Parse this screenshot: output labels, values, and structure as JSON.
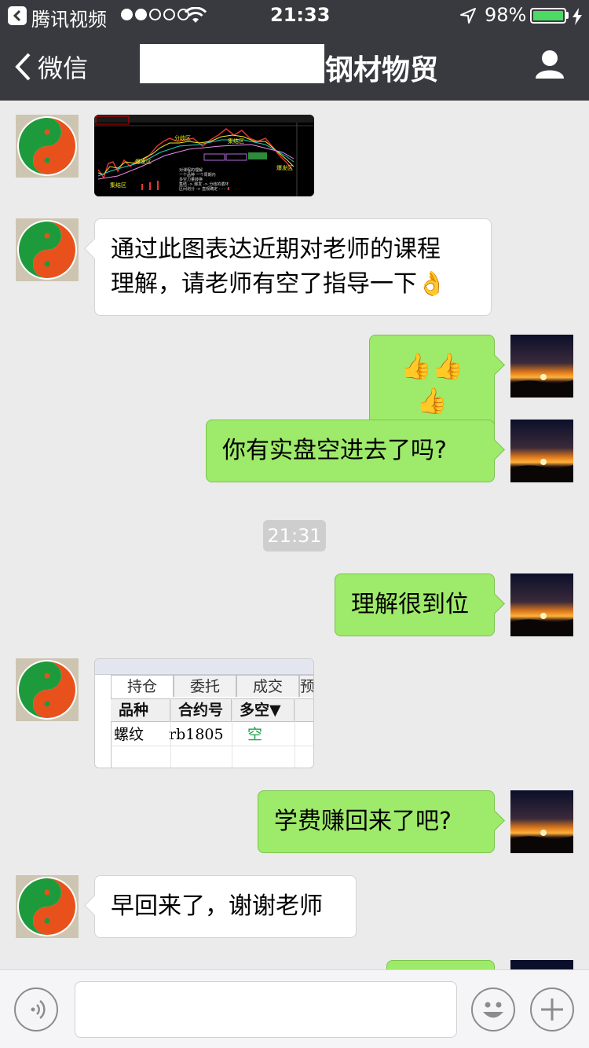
{
  "status_bar": {
    "back_app_label": "腾讯视频",
    "time": "21:33",
    "battery_percent": "98%",
    "signal_dots_filled": 2,
    "signal_dots_total": 5
  },
  "nav": {
    "back_label": "微信",
    "title_visible": "钢材物贸"
  },
  "messages": [
    {
      "side": "in",
      "type": "image",
      "image": "stock-chart",
      "chart_text": [
        "分歧区",
        "集结区",
        "爆发区",
        "集结区",
        "爆发区",
        "对课程的理解",
        "一个品种 一个周期内",
        "多空力量转换",
        "集结 -> 爆发 -> 分歧的循环",
        "区间划分 -> 直观确定 - - - -"
      ]
    },
    {
      "side": "in",
      "type": "text",
      "lines": [
        "通过此图表达近期对老师的课程",
        "理解，请老师有空了指导一下👌"
      ]
    },
    {
      "side": "out",
      "type": "text",
      "text": "👍👍👍"
    },
    {
      "side": "out",
      "type": "text",
      "text": "你有实盘空进去了吗?"
    },
    {
      "side": "system",
      "type": "time",
      "text": "21:31"
    },
    {
      "side": "out",
      "type": "text",
      "text": "理解很到位"
    },
    {
      "side": "in",
      "type": "image",
      "image": "positions-table",
      "tabs": [
        "持仓",
        "委托",
        "成交",
        "预"
      ],
      "columns": [
        "品种",
        "合约号",
        "多空▼"
      ],
      "row": [
        "螺纹",
        "rb1805",
        "空"
      ]
    },
    {
      "side": "out",
      "type": "text",
      "text": "学费赚回来了吧?"
    },
    {
      "side": "in",
      "type": "text",
      "text": "早回来了，谢谢老师"
    }
  ],
  "icons": {
    "left_avatar": "yin-yang-avatar-icon",
    "right_avatar": "sunset-avatar-icon",
    "voice": "voice-icon",
    "emoji": "emoji-icon",
    "more": "plus-icon",
    "profile": "person-icon"
  },
  "colors": {
    "nav_bg": "#393a3f",
    "chat_bg": "#ebebeb",
    "out_bubble": "#9eea6a",
    "in_bubble": "#ffffff",
    "time_pill": "#cecece",
    "battery": "#4cd964"
  }
}
